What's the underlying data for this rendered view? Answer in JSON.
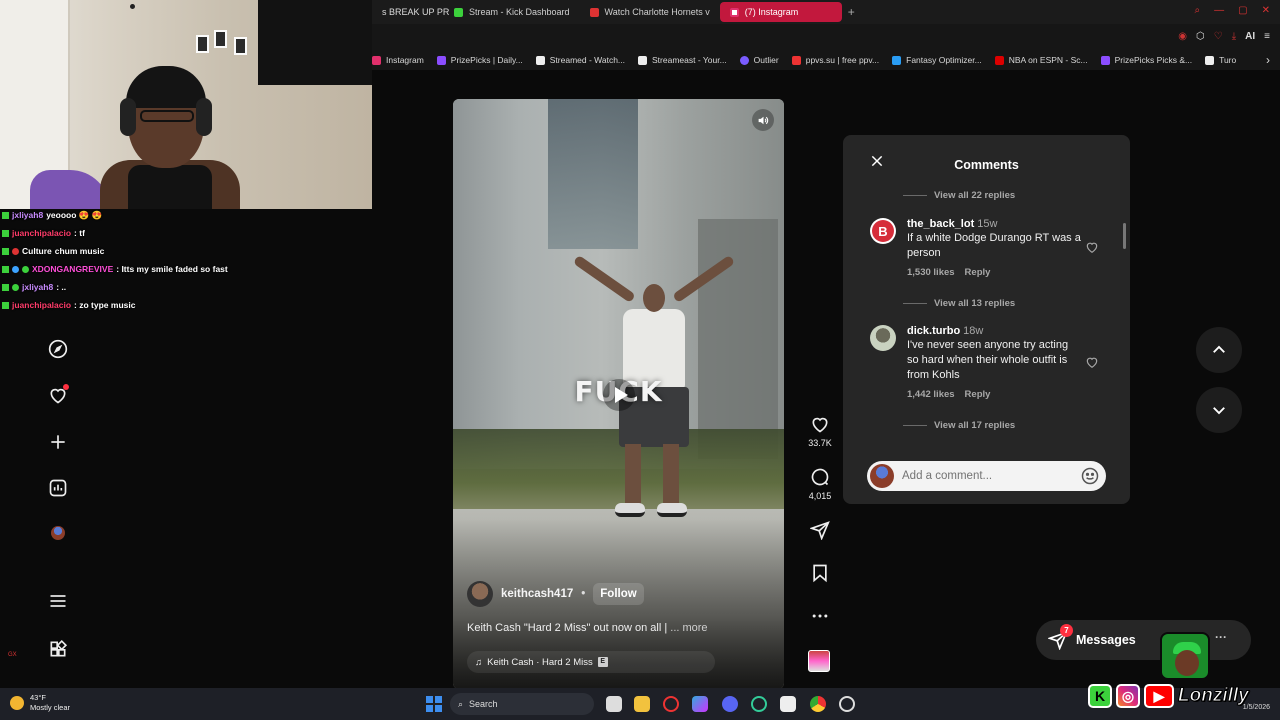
{
  "browser": {
    "tabs": [
      {
        "label": "s BREAK UP PR",
        "color": "#c33"
      },
      {
        "label": "Stream - Kick Dashboard",
        "color": "#3cd13c"
      },
      {
        "label": "Watch Charlotte Hornets v",
        "color": "#d33"
      },
      {
        "label": "(7) Instagram",
        "color": "#e1306c"
      }
    ],
    "new_tab_symbol": "+",
    "window_controls": [
      "search-icon",
      "minimize-icon",
      "maximize-icon",
      "close-icon"
    ],
    "toolbar_ai_label": "AI",
    "bookmarks": [
      {
        "label": "Instagram",
        "color": "#e1306c"
      },
      {
        "label": "PrizePicks | Daily...",
        "color": "#8b4dff"
      },
      {
        "label": "Streamed - Watch...",
        "color": "#eee"
      },
      {
        "label": "Streameast - Your...",
        "color": "#eee"
      },
      {
        "label": "Outlier",
        "color": "#7a5cff"
      },
      {
        "label": "ppvs.su | free ppv...",
        "color": "#e33"
      },
      {
        "label": "Fantasy Optimizer...",
        "color": "#2a9df4"
      },
      {
        "label": "NBA on ESPN - Sc...",
        "color": "#d00"
      },
      {
        "label": "PrizePicks Picks &...",
        "color": "#8b4dff"
      },
      {
        "label": "Turo",
        "color": "#eee"
      }
    ],
    "bookmarks_more": "›"
  },
  "chat": [
    {
      "user": "jxliyah8",
      "message": "yeoooo 😍 😍",
      "user_color": "#c98cff"
    },
    {
      "user": "juanchipalacio",
      "message": ": tf",
      "user_color": "#ff3c6a"
    },
    {
      "user": "Culture",
      "message": "chum music",
      "user_color": "#ffffff"
    },
    {
      "user": "XDONGANGREVIVE",
      "message": ": Itts my smile faded so fast",
      "user_color": "#ff4fd8"
    },
    {
      "user": "jxliyah8",
      "message": ": ..",
      "user_color": "#c98cff"
    },
    {
      "user": "juanchipalacio",
      "message": ": zo type music",
      "user_color": "#ff3c6a"
    }
  ],
  "nav": {
    "items": [
      "explore-icon",
      "notifications-icon",
      "create-icon",
      "dashboard-icon",
      "profile-avatar",
      "menu-icon",
      "apps-icon"
    ],
    "corner_text": "GX"
  },
  "reel": {
    "overlay_text": "FUCK",
    "author": "keithcash417",
    "separator": "•",
    "follow_label": "Follow",
    "caption": "Keith Cash \"Hard 2 Miss\" out now on all |",
    "caption_more": "... more",
    "audio": "Keith Cash · Hard 2 Miss",
    "explicit_badge": "E",
    "likes": "33.7K",
    "comments_count": "4,015"
  },
  "comments_panel": {
    "title": "Comments",
    "view_replies_top": "View all 22 replies",
    "items": [
      {
        "user": "the_back_lot",
        "time": "15w",
        "text": "If a white Dodge Durango RT was a person",
        "likes": "1,530 likes",
        "reply": "Reply",
        "view_replies": "View all 13 replies",
        "avatar_color": "#d62d3a",
        "avatar_letter": "B"
      },
      {
        "user": "dick.turbo",
        "time": "18w",
        "text": "I've never seen anyone try acting so hard when their whole outfit is from Kohls",
        "likes": "1,442 likes",
        "reply": "Reply",
        "view_replies": "View all 17 replies",
        "avatar_color": "#c9d2c0",
        "avatar_letter": ""
      }
    ],
    "add_comment_placeholder": "Add a comment..."
  },
  "messages": {
    "label": "Messages",
    "count": "7",
    "more": "···"
  },
  "branding": {
    "name": "Lonzilly",
    "kick_letter": "K"
  },
  "taskbar": {
    "weather_temp": "43°F",
    "weather_desc": "Mostly clear",
    "search_label": "Search",
    "date": "1/5/2026"
  }
}
